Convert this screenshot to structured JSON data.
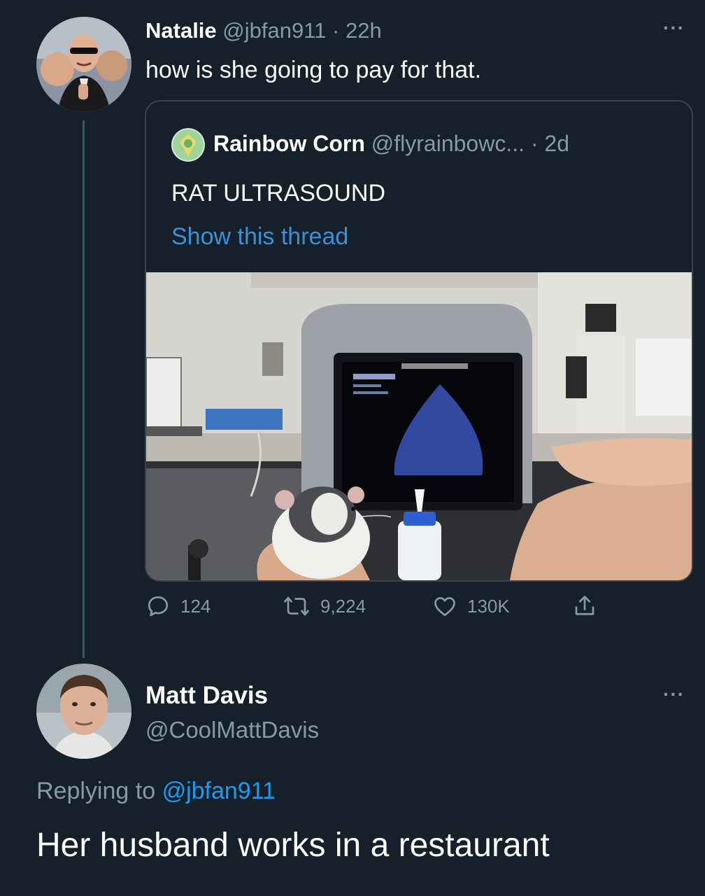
{
  "parent_tweet": {
    "author_name": "Natalie",
    "author_handle": "@jbfan911",
    "time": "· 22h",
    "text": "how is she going to pay for that.",
    "more_label": "···",
    "quoted_tweet": {
      "author_name": "Rainbow Corn",
      "author_handle": "@flyrainbowc...",
      "time": "· 2d",
      "text": "RAT ULTRASOUND",
      "show_thread_label": "Show this thread"
    },
    "actions": {
      "reply_count": "124",
      "retweet_count": "9,224",
      "like_count": "130K"
    }
  },
  "reply_tweet": {
    "author_name": "Matt Davis",
    "author_handle": "@CoolMattDavis",
    "more_label": "···",
    "replying_prefix": "Replying to",
    "replying_handle": "@jbfan911",
    "text": "Her husband works in a restaurant"
  },
  "icons": {
    "reply": "comment-bubble-icon",
    "retweet": "retweet-arrows-icon",
    "like": "heart-icon",
    "share": "share-upload-icon",
    "more": "ellipsis-icon"
  },
  "colors": {
    "background": "#15202b",
    "text": "#ffffff",
    "muted": "#8899a6",
    "link": "#1d9bf0",
    "border": "#38444d"
  }
}
